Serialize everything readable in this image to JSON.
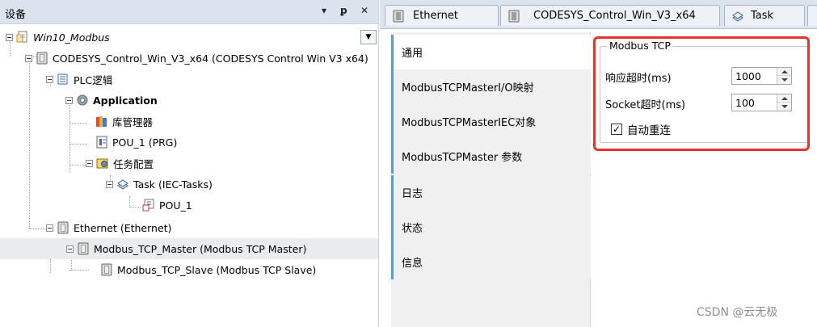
{
  "left_panel": {
    "title": "设备",
    "tree": [
      {
        "id": "root",
        "label": "Win10_Modbus",
        "italic": true
      },
      {
        "id": "device",
        "label": "CODESYS_Control_Win_V3_x64 (CODESYS Control Win V3 x64)"
      },
      {
        "id": "plc-logic",
        "label": "PLC逻辑"
      },
      {
        "id": "application",
        "label": "Application",
        "bold": true
      },
      {
        "id": "library-manager",
        "label": "库管理器"
      },
      {
        "id": "pou-prg",
        "label": "POU_1 (PRG)"
      },
      {
        "id": "task-config",
        "label": "任务配置"
      },
      {
        "id": "task",
        "label": "Task (IEC-Tasks)"
      },
      {
        "id": "pou-call",
        "label": "POU_1"
      },
      {
        "id": "ethernet",
        "label": "Ethernet (Ethernet)"
      },
      {
        "id": "modbus-master",
        "label": "Modbus_TCP_Master (Modbus TCP Master)",
        "selected": true
      },
      {
        "id": "modbus-slave",
        "label": "Modbus_TCP_Slave (Modbus TCP Slave)"
      }
    ]
  },
  "tabs": [
    "Ethernet",
    "CODESYS_Control_Win_V3_x64",
    "Task"
  ],
  "side_nav": [
    "通用",
    "ModbusTCPMasterI/O映射",
    "ModbusTCPMasterIEC对象",
    "ModbusTCPMaster 参数",
    "日志",
    "状态",
    "信息"
  ],
  "settings": {
    "group_title": "Modbus TCP",
    "response_timeout_label": "响应超时(ms)",
    "response_timeout_value": "1000",
    "socket_timeout_label": "Socket超时(ms)",
    "socket_timeout_value": "100",
    "auto_reconnect_label": "自动重连",
    "auto_reconnect_checked": true
  },
  "watermark": "CSDN @云无极",
  "colors": {
    "highlight": "#e8322d",
    "nav_accent": "#5b9bd5",
    "header_bg": "#dbe4ee"
  }
}
